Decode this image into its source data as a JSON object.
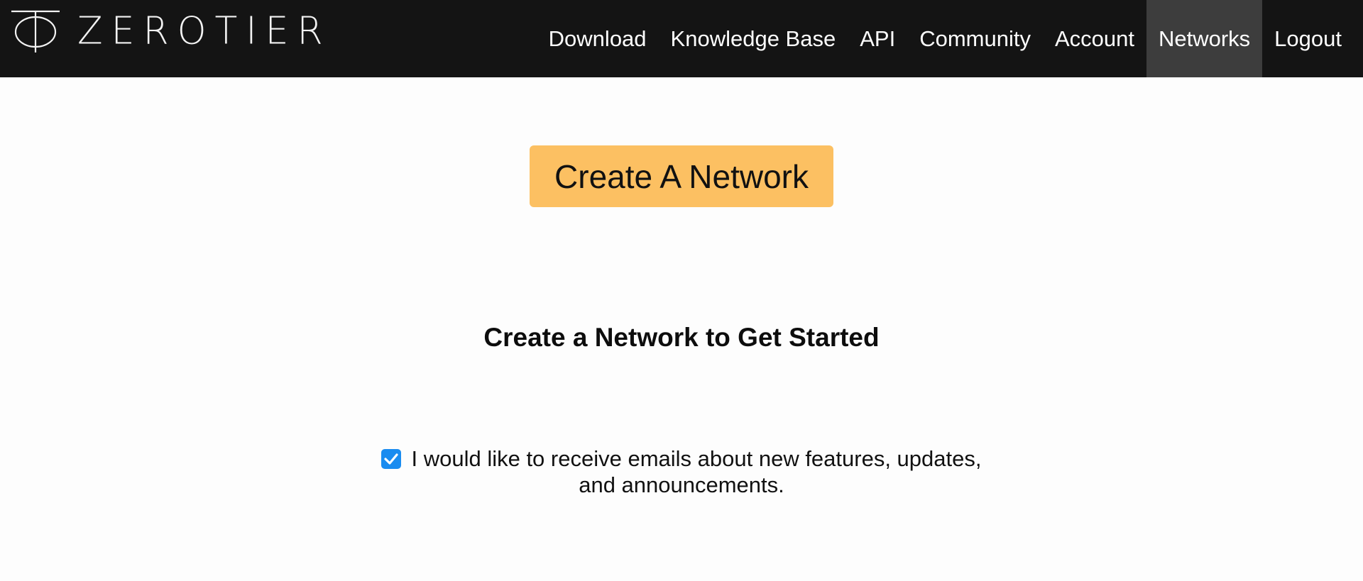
{
  "brand": {
    "name": "ZEROTIER"
  },
  "nav": {
    "items": [
      {
        "label": "Download",
        "active": false
      },
      {
        "label": "Knowledge Base",
        "active": false
      },
      {
        "label": "API",
        "active": false
      },
      {
        "label": "Community",
        "active": false
      },
      {
        "label": "Account",
        "active": false
      },
      {
        "label": "Networks",
        "active": true
      },
      {
        "label": "Logout",
        "active": false
      }
    ]
  },
  "main": {
    "create_button_label": "Create A Network",
    "heading": "Create a Network to Get Started",
    "optin": {
      "checked": true,
      "label": "I would like to receive emails about new features, updates, and announcements."
    }
  },
  "colors": {
    "navbar_bg": "#141414",
    "nav_active_bg": "#3d3d3d",
    "button_bg": "#fcc062",
    "checkbox_accent": "#1a8cf0",
    "page_bg": "#fdfdfd"
  },
  "icons": {
    "logo": "zerotier-phi-logo-icon",
    "checkbox": "checkmark-icon"
  }
}
